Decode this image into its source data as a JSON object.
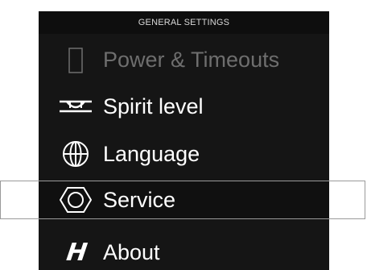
{
  "header": {
    "title": "GENERAL SETTINGS"
  },
  "menu": {
    "items": [
      {
        "label": "Power & Timeouts",
        "icon": "battery-icon"
      },
      {
        "label": "Spirit level",
        "icon": "spirit-level-icon"
      },
      {
        "label": "Language",
        "icon": "globe-icon"
      },
      {
        "label": "Service",
        "icon": "hex-nut-icon",
        "selected": true
      },
      {
        "label": "About",
        "icon": "hasselblad-h-logo"
      }
    ]
  },
  "colors": {
    "panel_bg": "#151515",
    "text": "#ffffff",
    "faded_text": "#6e6e6e",
    "selection_border": "#9a9a9a"
  },
  "logo_text": "H"
}
